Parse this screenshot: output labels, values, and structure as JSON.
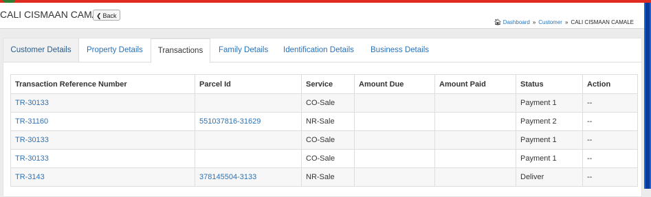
{
  "header": {
    "title": "CALI CISMAAN CAMALE",
    "back_label": "Back"
  },
  "breadcrumb": {
    "items": [
      "Dashboard",
      "Customer",
      "CALI CISMAAN CAMALE"
    ],
    "separator": "»"
  },
  "tabs": [
    {
      "label": "Customer Details"
    },
    {
      "label": "Property Details"
    },
    {
      "label": "Transactions"
    },
    {
      "label": "Family Details"
    },
    {
      "label": "Identification Details"
    },
    {
      "label": "Business Details"
    }
  ],
  "table": {
    "columns": [
      "Transaction Reference Number",
      "Parcel Id",
      "Service",
      "Amount Due",
      "Amount Paid",
      "Status",
      "Action"
    ],
    "rows": [
      {
        "ref": "TR-30133",
        "parcel": "",
        "service": "CO-Sale",
        "due": "",
        "paid": "",
        "status": "Payment 1",
        "action": "--"
      },
      {
        "ref": "TR-31160",
        "parcel": "551037816-31629",
        "service": "NR-Sale",
        "due": "",
        "paid": "",
        "status": "Payment 2",
        "action": "--"
      },
      {
        "ref": "TR-30133",
        "parcel": "",
        "service": "CO-Sale",
        "due": "",
        "paid": "",
        "status": "Payment 1",
        "action": "--"
      },
      {
        "ref": "TR-30133",
        "parcel": "",
        "service": "CO-Sale",
        "due": "",
        "paid": "",
        "status": "Payment 1",
        "action": "--"
      },
      {
        "ref": "TR-3143",
        "parcel": "378145504-3133",
        "service": "NR-Sale",
        "due": "",
        "paid": "",
        "status": "Deliver",
        "action": "--"
      }
    ]
  },
  "colors": {
    "link": "#2a72b8",
    "top_bar": "#e02b20",
    "right_strip": "#1b62d8"
  }
}
